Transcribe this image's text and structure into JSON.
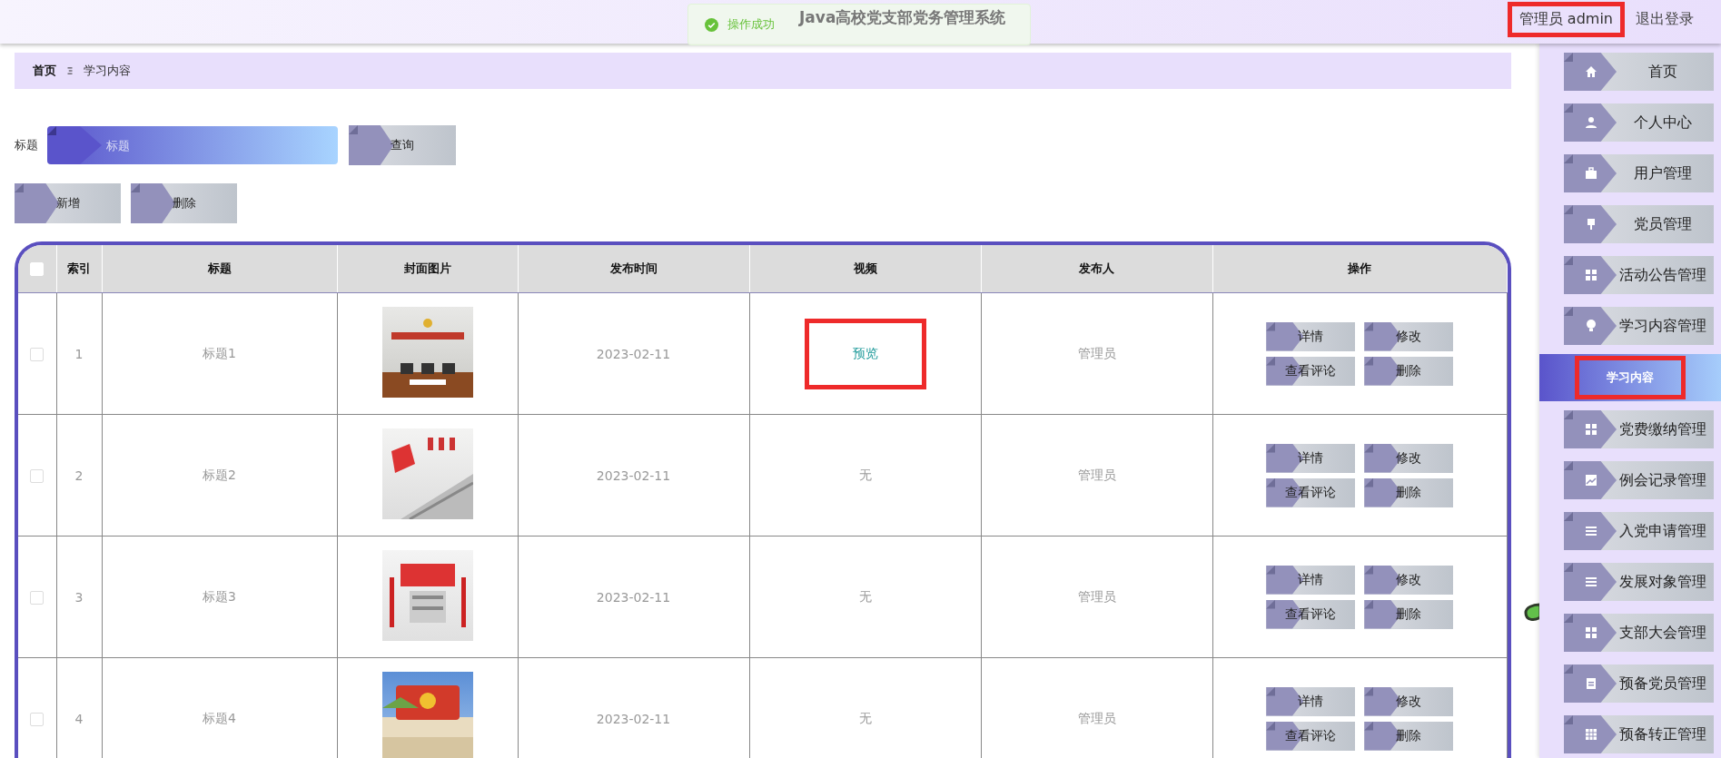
{
  "header": {
    "title": "Java高校党支部党务管理系统",
    "user": {
      "text": "管理员 admin",
      "highlighted": true
    },
    "logout": "退出登录"
  },
  "toast": {
    "text": "操作成功"
  },
  "breadcrumb": {
    "items": [
      "首页",
      "学习内容"
    ]
  },
  "search": {
    "label": "标题",
    "placeholder": "标题",
    "button": "查询"
  },
  "toolbar": [
    "新增",
    "删除"
  ],
  "table": {
    "select_all_checked": false,
    "columns": [
      "索引",
      "标题",
      "封面图片",
      "发布时间",
      "视频",
      "发布人",
      "操作"
    ],
    "rows": [
      {
        "checked": false,
        "index": "1",
        "title": "标题1",
        "date": "2023-02-11",
        "video": {
          "kind": "link",
          "text": "预览",
          "highlighted": true
        },
        "publisher": "管理员",
        "actions": [
          "详情",
          "修改",
          "查看评论",
          "删除"
        ]
      },
      {
        "checked": false,
        "index": "2",
        "title": "标题2",
        "date": "2023-02-11",
        "video": {
          "kind": "plain",
          "text": "无",
          "highlighted": false
        },
        "publisher": "管理员",
        "actions": [
          "详情",
          "修改",
          "查看评论",
          "删除"
        ]
      },
      {
        "checked": false,
        "index": "3",
        "title": "标题3",
        "date": "2023-02-11",
        "video": {
          "kind": "plain",
          "text": "无",
          "highlighted": false
        },
        "publisher": "管理员",
        "actions": [
          "详情",
          "修改",
          "查看评论",
          "删除"
        ]
      },
      {
        "checked": false,
        "index": "4",
        "title": "标题4",
        "date": "2023-02-11",
        "video": {
          "kind": "plain",
          "text": "无",
          "highlighted": false
        },
        "publisher": "管理员",
        "actions": [
          "详情",
          "修改",
          "查看评论",
          "删除"
        ]
      }
    ]
  },
  "sidebar": {
    "items": [
      {
        "label": "首页",
        "selected": false,
        "highlighted": false
      },
      {
        "label": "个人中心",
        "selected": false,
        "highlighted": false
      },
      {
        "label": "用户管理",
        "selected": false,
        "highlighted": false
      },
      {
        "label": "党员管理",
        "selected": false,
        "highlighted": false
      },
      {
        "label": "活动公告管理",
        "selected": false,
        "highlighted": false
      },
      {
        "label": "学习内容管理",
        "selected": false,
        "highlighted": false
      },
      {
        "label": "学习内容",
        "selected": true,
        "highlighted": true
      },
      {
        "label": "党费缴纳管理",
        "selected": false,
        "highlighted": false
      },
      {
        "label": "例会记录管理",
        "selected": false,
        "highlighted": false
      },
      {
        "label": "入党申请管理",
        "selected": false,
        "highlighted": false
      },
      {
        "label": "发展对象管理",
        "selected": false,
        "highlighted": false
      },
      {
        "label": "支部大会管理",
        "selected": false,
        "highlighted": false
      },
      {
        "label": "预备党员管理",
        "selected": false,
        "highlighted": false
      },
      {
        "label": "预备转正管理",
        "selected": false,
        "highlighted": false
      }
    ]
  }
}
